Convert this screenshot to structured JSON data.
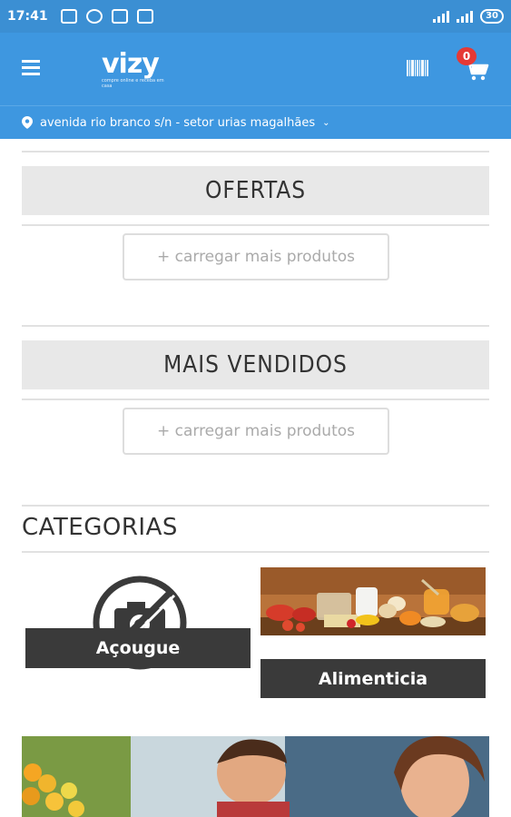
{
  "status_bar": {
    "time": "17:41",
    "battery": "30"
  },
  "app_bar": {
    "logo_text": "vizy",
    "logo_tagline": "compre online e receba em casa",
    "cart_count": "0"
  },
  "location": {
    "address": "avenida rio branco s/n - setor urias magalhães"
  },
  "sections": [
    {
      "title": "OFERTAS",
      "load_more_label": "+ carregar mais produtos"
    },
    {
      "title": "MAIS VENDIDOS",
      "load_more_label": "+ carregar mais produtos"
    }
  ],
  "categories": {
    "title": "CATEGORIAS",
    "items": [
      {
        "label": "Açougue",
        "image": "no-image-placeholder"
      },
      {
        "label": "Alimenticia",
        "image": "food-photo"
      }
    ]
  },
  "colors": {
    "primary": "#3e97e0",
    "status_bar": "#3b8fd3",
    "badge": "#e53935",
    "label_bg": "#3a3a3a",
    "section_bg": "#e8e8e8"
  }
}
